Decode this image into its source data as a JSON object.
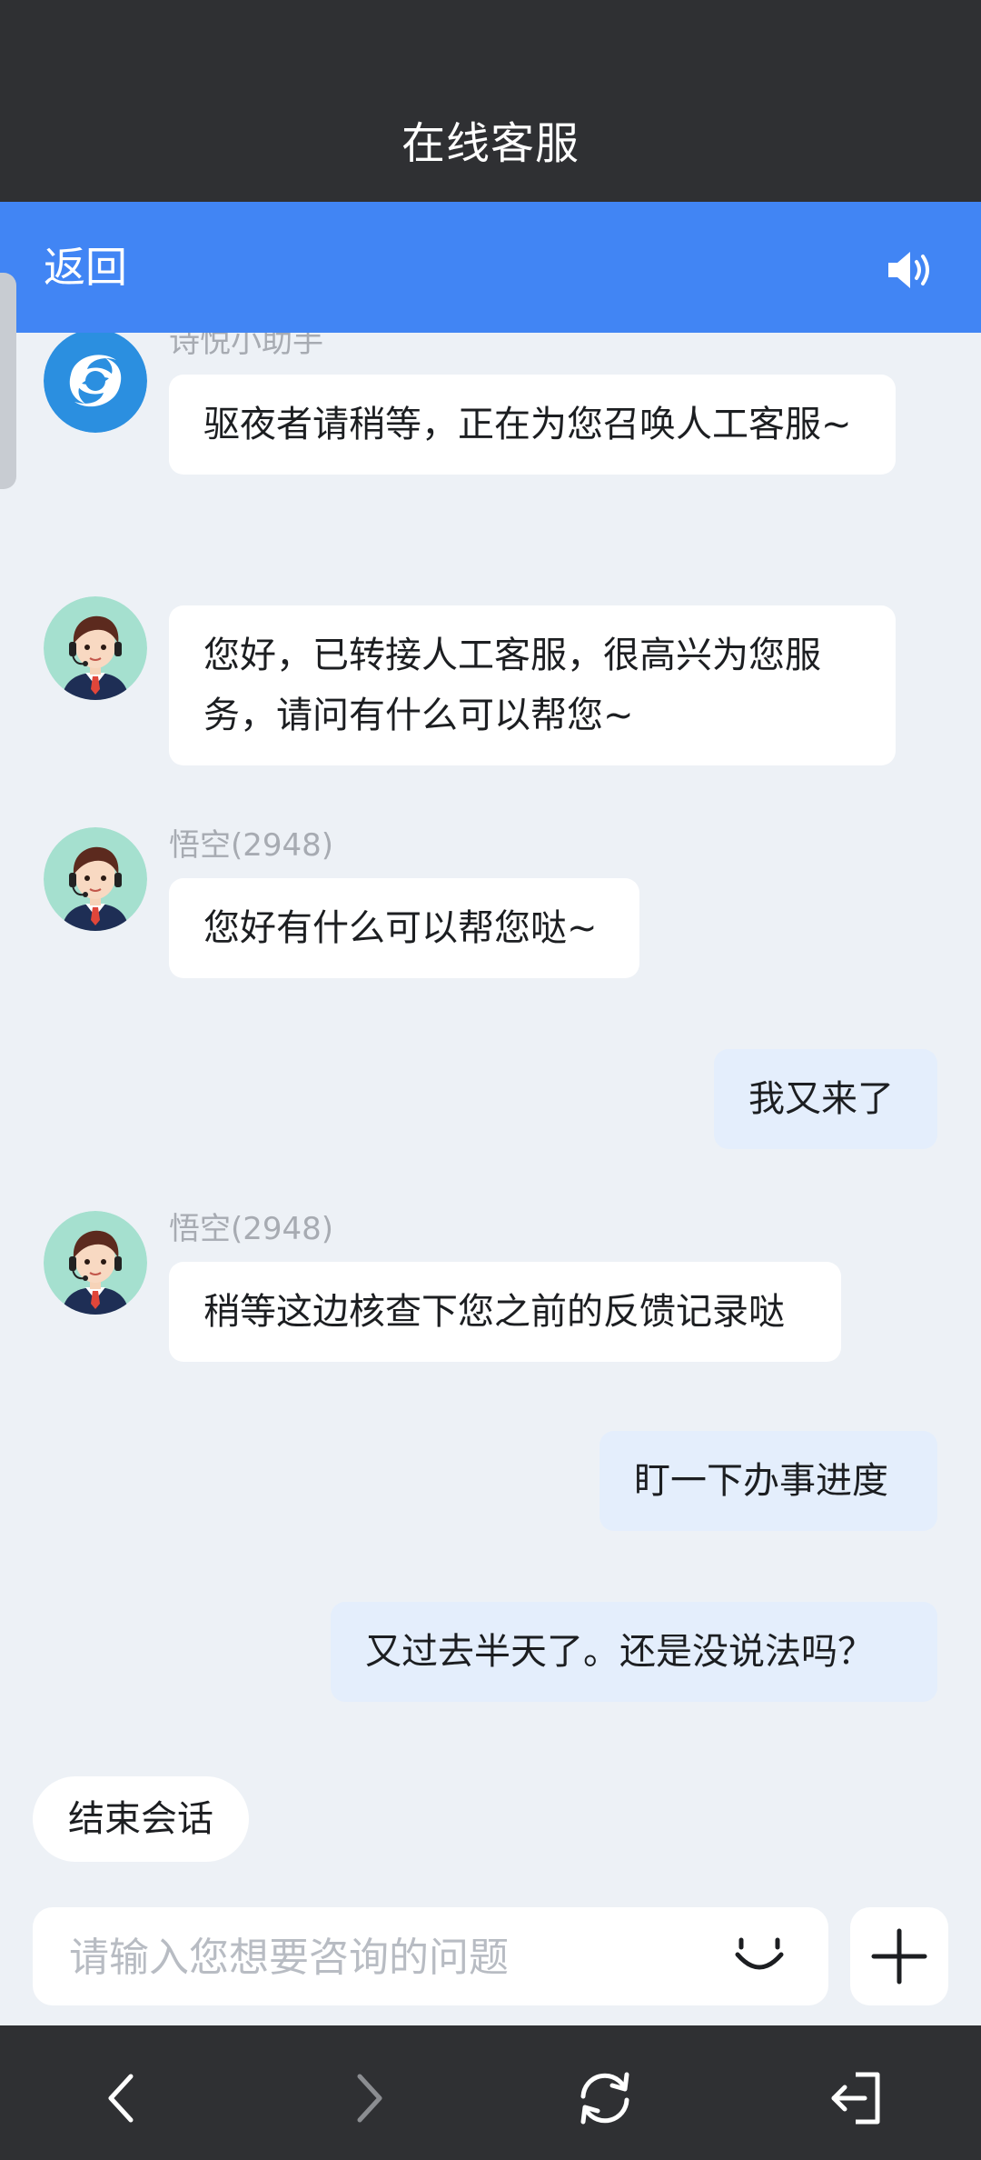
{
  "header": {
    "title": "在线客服"
  },
  "nav": {
    "back_label": "返回"
  },
  "messages": [
    {
      "sender": "诗悦小助手",
      "text": "驱夜者请稍等，正在为您召唤人工客服~"
    },
    {
      "text": "您好，已转接人工客服，很高兴为您服务，请问有什么可以帮您~"
    },
    {
      "sender": "悟空(2948)",
      "text": "您好有什么可以帮您哒~"
    },
    {
      "text": "我又来了"
    },
    {
      "sender": "悟空(2948)",
      "text": "稍等这边核查下您之前的反馈记录哒"
    },
    {
      "text": "盯一下办事进度"
    },
    {
      "text": "又过去半天了。还是没说法吗？"
    }
  ],
  "actions": {
    "end_session": "结束会话"
  },
  "composer": {
    "placeholder": "请输入您想要咨询的问题",
    "value": ""
  },
  "colors": {
    "nav_blue": "#4185f4",
    "dark_bar": "#2f3033",
    "chat_bg": "#edf1f6",
    "outgoing_bubble": "#e4eefc"
  },
  "icons": {
    "speaker": "speaker-icon",
    "bot_avatar": "bot-avatar-icon",
    "agent_avatar": "agent-avatar-icon",
    "emoji": "smiley-icon",
    "plus": "plus-icon",
    "back": "chevron-left-icon",
    "forward": "chevron-right-icon",
    "refresh": "refresh-icon",
    "exit": "exit-icon"
  }
}
